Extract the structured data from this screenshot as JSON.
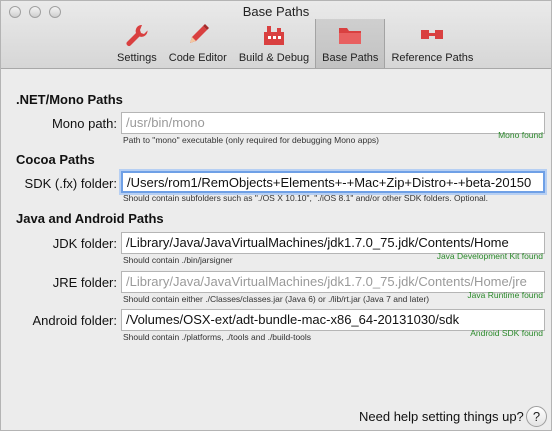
{
  "window": {
    "title": "Base Paths"
  },
  "toolbar": {
    "tabs": [
      {
        "label": "Settings",
        "icon": "wrench-icon"
      },
      {
        "label": "Code Editor",
        "icon": "pencil-icon"
      },
      {
        "label": "Build & Debug",
        "icon": "build-icon"
      },
      {
        "label": "Base Paths",
        "icon": "folder-icon",
        "active": true
      },
      {
        "label": "Reference Paths",
        "icon": "reference-icon"
      }
    ],
    "accent_color": "#d94040"
  },
  "sections": {
    "dotnet": {
      "title": ".NET/Mono Paths",
      "mono": {
        "label": "Mono path:",
        "value": "/usr/bin/mono",
        "hint": "Path to \"mono\" executable (only required for debugging Mono apps)",
        "status": "Mono found"
      }
    },
    "cocoa": {
      "title": "Cocoa Paths",
      "sdk": {
        "label": "SDK (.fx) folder:",
        "value": "/Users/rom1/RemObjects+Elements+-+Mac+Zip+Distro+-+beta-20150",
        "hint": "Should contain subfolders such as \"./OS X 10.10\", \"./iOS 8.1\" and/or other SDK folders. Optional."
      }
    },
    "java": {
      "title": "Java and Android Paths",
      "jdk": {
        "label": "JDK folder:",
        "value": "/Library/Java/JavaVirtualMachines/jdk1.7.0_75.jdk/Contents/Home",
        "hint": "Should contain ./bin/jarsigner",
        "status": "Java Development Kit found"
      },
      "jre": {
        "label": "JRE folder:",
        "value": "/Library/Java/JavaVirtualMachines/jdk1.7.0_75.jdk/Contents/Home/jre",
        "hint": "Should contain either ./Classes/classes.jar (Java 6) or ./lib/rt.jar (Java 7 and later)",
        "status": "Java Runtime found"
      },
      "android": {
        "label": "Android folder:",
        "value": "/Volumes/OSX-ext/adt-bundle-mac-x86_64-20131030/sdk",
        "hint": "Should contain ./platforms, ./tools and ./build-tools",
        "status": "Android SDK found"
      }
    }
  },
  "help": {
    "text": "Need help setting things up?",
    "button": "?"
  },
  "colors": {
    "status_green": "#2b8a2b",
    "focus_blue": "#6fa0e6"
  }
}
